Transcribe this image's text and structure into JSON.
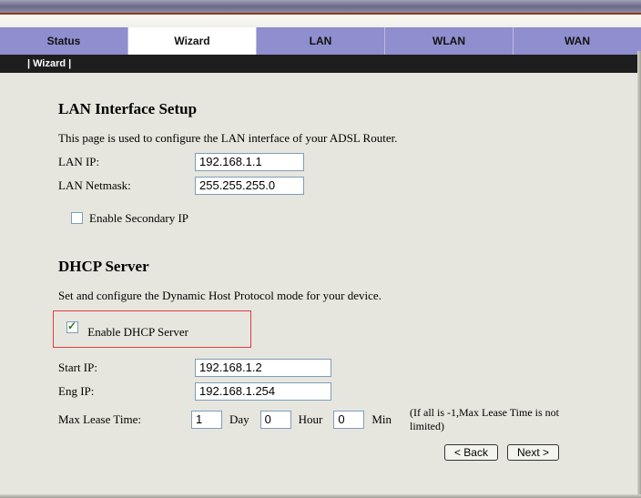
{
  "tabs": [
    "Status",
    "Wizard",
    "LAN",
    "WLAN",
    "WAN"
  ],
  "breadcrumb": "|  Wizard  |",
  "lan": {
    "heading": "LAN Interface Setup",
    "desc": "This page is used to configure the LAN interface of your ADSL Router.",
    "ip_label": "LAN IP:",
    "ip_value": "192.168.1.1",
    "mask_label": "LAN Netmask:",
    "mask_value": "255.255.255.0",
    "sec_label": "Enable Secondary IP",
    "sec_checked": false
  },
  "dhcp": {
    "heading": "DHCP Server",
    "desc": "Set and configure the Dynamic Host Protocol mode for your device.",
    "enable_label": "Enable DHCP Server",
    "enable_checked": true,
    "start_label": "Start IP:",
    "start_value": "192.168.1.2",
    "end_label": "Eng IP:",
    "end_value": "192.168.1.254",
    "lease_label": "Max Lease Time:",
    "lease_day": "1",
    "lease_hour": "0",
    "lease_min": "0",
    "unit_day": "Day",
    "unit_hour": "Hour",
    "unit_min": "Min",
    "lease_hint": "(If all is -1,Max Lease Time is not limited)"
  },
  "buttons": {
    "back": "< Back",
    "next": "Next >"
  }
}
